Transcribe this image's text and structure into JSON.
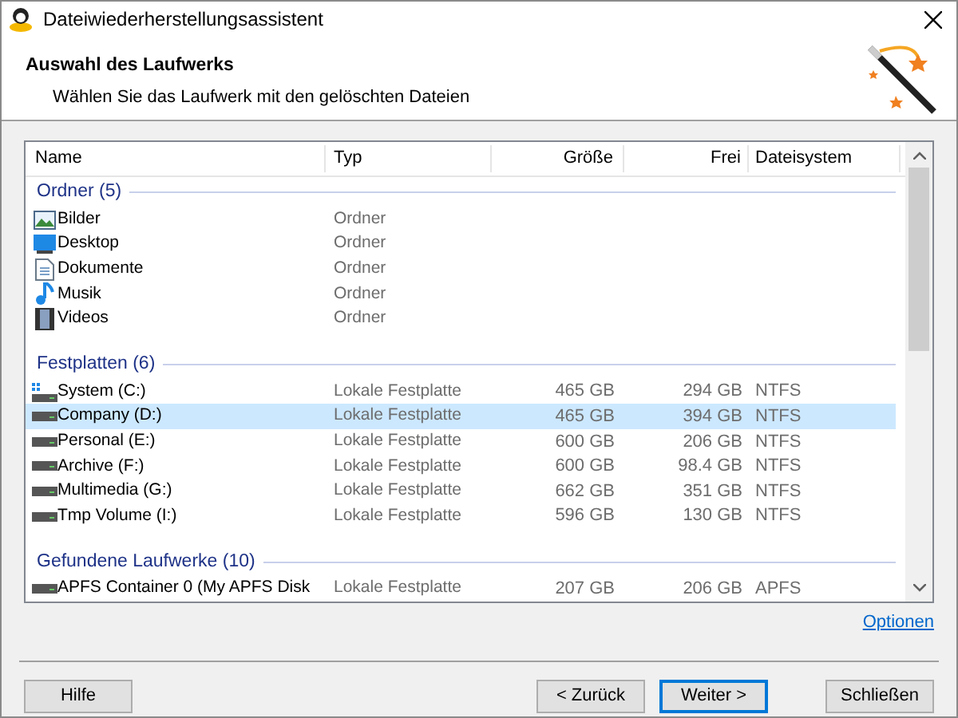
{
  "window": {
    "title": "Dateiwiederherstellungsassistent"
  },
  "header": {
    "title": "Auswahl des Laufwerks",
    "subtitle": "Wählen Sie das Laufwerk mit den gelöschten Dateien"
  },
  "table": {
    "columns": [
      "Name",
      "Typ",
      "Größe",
      "Frei",
      "Dateisystem"
    ],
    "groups": [
      {
        "title": "Ordner (5)",
        "rows": [
          {
            "kind": "pictures",
            "name": "Bilder",
            "type": "Ordner",
            "selected": false
          },
          {
            "kind": "desktop",
            "name": "Desktop",
            "type": "Ordner",
            "selected": false
          },
          {
            "kind": "documents",
            "name": "Dokumente",
            "type": "Ordner",
            "selected": false
          },
          {
            "kind": "music",
            "name": "Musik",
            "type": "Ordner",
            "selected": false
          },
          {
            "kind": "videos",
            "name": "Videos",
            "type": "Ordner",
            "selected": false
          }
        ]
      },
      {
        "title": "Festplatten (6)",
        "rows": [
          {
            "kind": "system",
            "name": "System (C:)",
            "type": "Lokale Festplatte",
            "size": "465 GB",
            "free": "294 GB",
            "fs": "NTFS",
            "selected": false
          },
          {
            "kind": "drive",
            "name": "Company (D:)",
            "type": "Lokale Festplatte",
            "size": "465 GB",
            "free": "394 GB",
            "fs": "NTFS",
            "selected": true
          },
          {
            "kind": "drive",
            "name": "Personal (E:)",
            "type": "Lokale Festplatte",
            "size": "600 GB",
            "free": "206 GB",
            "fs": "NTFS",
            "selected": false
          },
          {
            "kind": "drive",
            "name": "Archive (F:)",
            "type": "Lokale Festplatte",
            "size": "600 GB",
            "free": "98.4 GB",
            "fs": "NTFS",
            "selected": false
          },
          {
            "kind": "drive",
            "name": "Multimedia (G:)",
            "type": "Lokale Festplatte",
            "size": "662 GB",
            "free": "351 GB",
            "fs": "NTFS",
            "selected": false
          },
          {
            "kind": "drive",
            "name": "Tmp Volume (I:)",
            "type": "Lokale Festplatte",
            "size": "596 GB",
            "free": "130 GB",
            "fs": "NTFS",
            "selected": false
          }
        ]
      },
      {
        "title": "Gefundene Laufwerke (10)",
        "rows": [
          {
            "kind": "drive",
            "name": "APFS Container 0 (My APFS Disk",
            "type": "Lokale Festplatte",
            "size": "207 GB",
            "free": "206 GB",
            "fs": "APFS",
            "selected": false
          }
        ]
      }
    ]
  },
  "options_link": "Optionen",
  "buttons": [
    {
      "label": "Hilfe",
      "kind": "help"
    },
    {
      "label": "< Zurück",
      "kind": "nav"
    },
    {
      "label": "Weiter >",
      "kind": "default"
    },
    {
      "label": "Schließen",
      "kind": "close"
    }
  ]
}
